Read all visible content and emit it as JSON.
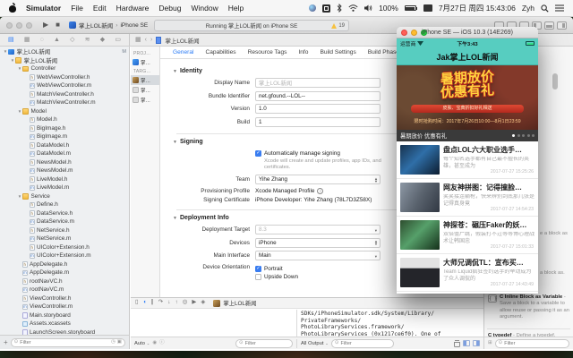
{
  "menubar": {
    "items": [
      "Simulator",
      "File",
      "Edit",
      "Hardware",
      "Debug",
      "Window",
      "Help"
    ],
    "status": {
      "battery_pct": "100%",
      "datetime": "7月27日 周四 15:43:06",
      "user": "Zyh"
    }
  },
  "xcode": {
    "toolbar": {
      "scheme_app": "掌上LOL新闻",
      "scheme_device": "iPhone SE",
      "activity_text": "Running 掌上LOL新闻 on iPhone SE",
      "warning_count": "19"
    },
    "jumpbar": {
      "project": "掌上LOL新闻"
    },
    "navigator": {
      "tree": [
        {
          "depth": 0,
          "type": "project",
          "label": "掌上LOL新闻",
          "badge": "M",
          "disc": true
        },
        {
          "depth": 1,
          "type": "group",
          "label": "掌上LOL新闻",
          "disc": true
        },
        {
          "depth": 2,
          "type": "group",
          "label": "Controller",
          "disc": true
        },
        {
          "depth": 3,
          "type": "h",
          "label": "WebViewController.h"
        },
        {
          "depth": 3,
          "type": "m",
          "label": "WebViewController.m"
        },
        {
          "depth": 3,
          "type": "h",
          "label": "MatchViewController.h"
        },
        {
          "depth": 3,
          "type": "m",
          "label": "MatchViewController.m"
        },
        {
          "depth": 2,
          "type": "group",
          "label": "Model",
          "disc": true
        },
        {
          "depth": 3,
          "type": "h",
          "label": "Model.h"
        },
        {
          "depth": 3,
          "type": "h",
          "label": "BigImage.h"
        },
        {
          "depth": 3,
          "type": "m",
          "label": "BigImage.m"
        },
        {
          "depth": 3,
          "type": "h",
          "label": "DataModel.h"
        },
        {
          "depth": 3,
          "type": "m",
          "label": "DataModel.m"
        },
        {
          "depth": 3,
          "type": "h",
          "label": "NewsModel.h"
        },
        {
          "depth": 3,
          "type": "m",
          "label": "NewsModel.m"
        },
        {
          "depth": 3,
          "type": "h",
          "label": "LiveModel.h"
        },
        {
          "depth": 3,
          "type": "m",
          "label": "LiveModel.m"
        },
        {
          "depth": 2,
          "type": "group",
          "label": "Service",
          "disc": true
        },
        {
          "depth": 3,
          "type": "h",
          "label": "Define.h"
        },
        {
          "depth": 3,
          "type": "h",
          "label": "DataService.h"
        },
        {
          "depth": 3,
          "type": "m",
          "label": "DataService.m"
        },
        {
          "depth": 3,
          "type": "h",
          "label": "NetService.h"
        },
        {
          "depth": 3,
          "type": "m",
          "label": "NetService.m"
        },
        {
          "depth": 3,
          "type": "h",
          "label": "UIColor+Extension.h"
        },
        {
          "depth": 3,
          "type": "m",
          "label": "UIColor+Extension.m"
        },
        {
          "depth": 2,
          "type": "h",
          "label": "AppDelegate.h"
        },
        {
          "depth": 2,
          "type": "m",
          "label": "AppDelegate.m"
        },
        {
          "depth": 2,
          "type": "h",
          "label": "rootNavVC.h"
        },
        {
          "depth": 2,
          "type": "m",
          "label": "rootNavVC.m"
        },
        {
          "depth": 2,
          "type": "h",
          "label": "ViewController.h"
        },
        {
          "depth": 2,
          "type": "m",
          "label": "ViewController.m"
        },
        {
          "depth": 2,
          "type": "sb",
          "label": "Main.storyboard"
        },
        {
          "depth": 2,
          "type": "assets",
          "label": "Assets.xcassets"
        },
        {
          "depth": 2,
          "type": "sb",
          "label": "LaunchScreen.storyboard"
        }
      ],
      "filter_placeholder": "Filter"
    },
    "editor": {
      "project_header": "PROJ…",
      "targets_header": "TARG…",
      "project_item": "掌…",
      "target_items": [
        "掌…",
        "掌…",
        "掌…"
      ],
      "tabs": [
        "General",
        "Capabilities",
        "Resource Tags",
        "Info",
        "Build Settings",
        "Build Phases"
      ],
      "active_tab": "General",
      "identity": {
        "title": "Identity",
        "display_name_label": "Display Name",
        "display_name_placeholder": "掌上LOL新闻",
        "bundle_label": "Bundle Identifier",
        "bundle_value": "net.gfound.--LOL--",
        "version_label": "Version",
        "version_value": "1.0",
        "build_label": "Build",
        "build_value": "1"
      },
      "signing": {
        "title": "Signing",
        "auto_label": "Automatically manage signing",
        "auto_desc": "Xcode will create and update profiles, app IDs, and certificates.",
        "team_label": "Team",
        "team_value": "Yihe Zhang",
        "profile_label": "Provisioning Profile",
        "profile_value": "Xcode Managed Profile",
        "cert_label": "Signing Certificate",
        "cert_value": "iPhone Developer: Yihe Zhang (78L7D3Z58X)"
      },
      "deployment": {
        "title": "Deployment Info",
        "target_label": "Deployment Target",
        "target_value": "8.3",
        "devices_label": "Devices",
        "devices_value": "iPhone",
        "interface_label": "Main Interface",
        "interface_value": "Main",
        "orientation_label": "Device Orientation",
        "portrait": "Portrait",
        "upsidedown": "Upside Down"
      }
    },
    "debug": {
      "app_label": "掌上LOL新闻",
      "icons": [
        {
          "name": "hide-debug-area-icon",
          "glyph": "▯"
        },
        {
          "name": "breakpoints-toggle-icon",
          "glyph": "◖",
          "blue": true
        },
        {
          "name": "pause-icon",
          "glyph": "∥"
        },
        {
          "name": "step-over-icon",
          "glyph": "↷"
        },
        {
          "name": "step-into-icon",
          "glyph": "↓"
        },
        {
          "name": "step-out-icon",
          "glyph": "↑"
        },
        {
          "name": "view-debugger-icon",
          "glyph": "◎"
        },
        {
          "name": "memory-debugger-icon",
          "glyph": "▶"
        },
        {
          "name": "location-icon",
          "glyph": "◈"
        }
      ],
      "variables_scope": "Auto",
      "console_scope": "All Output",
      "filter_placeholder": "Filter",
      "console_lines": [
        "SDKs/iPhoneSimulator.sdk/System/Library/",
        "PrivateFrameworks/",
        "PhotoLibraryServices.framework/",
        "PhotoLibraryServices (0x1217ce6f0). One of",
        "the two will be used. Which one is undefined."
      ]
    },
    "snippets": {
      "fragment1": "e a block as",
      "fragment2": "a block as.",
      "items": [
        {
          "title": "C Inline Block as Variable",
          "desc": " - Save a block to a variable to allow reuse or passing it as an argument."
        },
        {
          "title": "C typedef",
          "desc": " - Define a typedef."
        }
      ]
    }
  },
  "simulator": {
    "window_title": "iPhone SE — iOS 10.3 (14E269)",
    "app": {
      "carrier": "运营商",
      "time": "下午3:43",
      "nav_title": "Jak掌上LOL新闻",
      "banner": {
        "line1": "暑期放价",
        "line2": "优惠有礼",
        "ribbon": "皮肤、宝典折扣好礼相送",
        "period": "限时抢购时间：2017年7月26日10:00—8月1日23:59",
        "caption": "暑期放价 优惠有礼",
        "dots_total": 5,
        "dot_active": 0
      },
      "news": [
        {
          "title": "盘点LOL六大职业选手…",
          "subtitle": "每个知名选手都有自己最不擅长的英雄，甚至成为",
          "time": "2017-07-27 15:25:26"
        },
        {
          "title": "网友神拼图：记得撞脸…",
          "subtitle": "笑笑接连躺枪，快来辨别到底那几张是记得真身竟",
          "time": "2017-07-27 14:54:23"
        },
        {
          "title": "神探苍：碾压Faker的妖…",
          "subtitle": "双倍僵尸跳，假装打不过等等博心理战术让韩国忠",
          "time": "2017-07-27 15:01:33"
        },
        {
          "title": "大师兄调侃TL：宣布买…",
          "subtitle": "Team Liquid疯狂签约选手的举动成为了众人调侃的",
          "time": "2017-07-27 14:43:49"
        }
      ]
    }
  },
  "colors": {
    "teal": "#57cdc0",
    "xcode_accent": "#2a7bf6",
    "headline_yellow": "#ffd23e"
  }
}
